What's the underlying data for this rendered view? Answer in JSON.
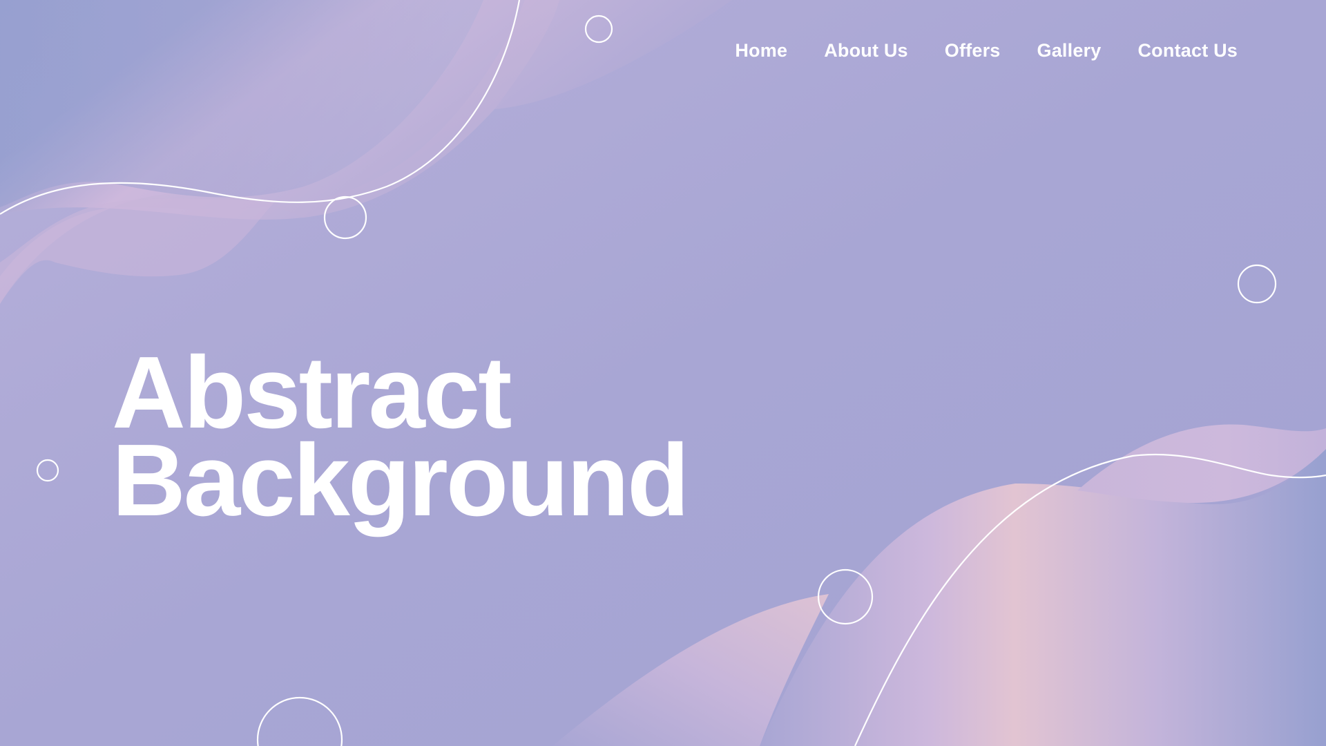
{
  "nav": {
    "items": [
      {
        "label": "Home"
      },
      {
        "label": "About Us"
      },
      {
        "label": "Offers"
      },
      {
        "label": "Gallery"
      },
      {
        "label": "Contact Us"
      }
    ]
  },
  "hero": {
    "line1": "Abstract",
    "line2": "Background"
  },
  "colors": {
    "base": "#a8a6d4",
    "blue": "#97a0d0",
    "lilac": "#c9b6da",
    "pink": "#e2c4d2",
    "text": "#ffffff"
  }
}
